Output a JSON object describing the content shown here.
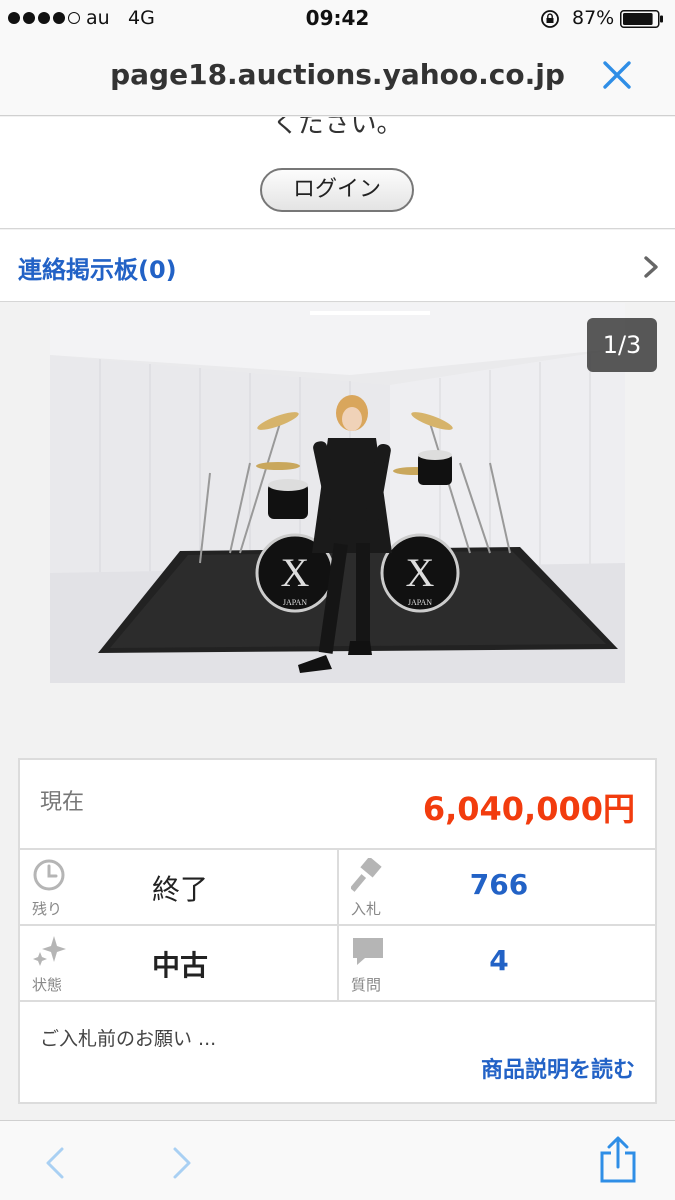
{
  "status_bar": {
    "carrier": "au",
    "network": "4G",
    "time": "09:42",
    "battery": "87%",
    "signal_bars_filled": 4,
    "signal_bars_total": 5,
    "battery_level": 0.87
  },
  "browser": {
    "url": "page18.auctions.yahoo.co.jp",
    "close_icon": "close-icon"
  },
  "page": {
    "cut_off_text": "ください。",
    "login_button": "ログイン",
    "message_board": "連絡掲示板(0)",
    "image_counter": "1/3",
    "drum_logo_text": "X",
    "drum_brand_text": "JAPAN",
    "price_label": "現在",
    "price_value": "6,040,000円",
    "time_left_label": "残り",
    "time_left_value": "終了",
    "bids_label": "入札",
    "bids_value": "766",
    "condition_label": "状態",
    "condition_value": "中古",
    "questions_label": "質問",
    "questions_value": "4",
    "notice_text": "ご入札前のお願い ...",
    "read_description_link": "商品説明を読む"
  },
  "colors": {
    "link_blue": "#2262c6",
    "price_red": "#f23c0e",
    "toolbar_blue": "#2f8ee6"
  }
}
